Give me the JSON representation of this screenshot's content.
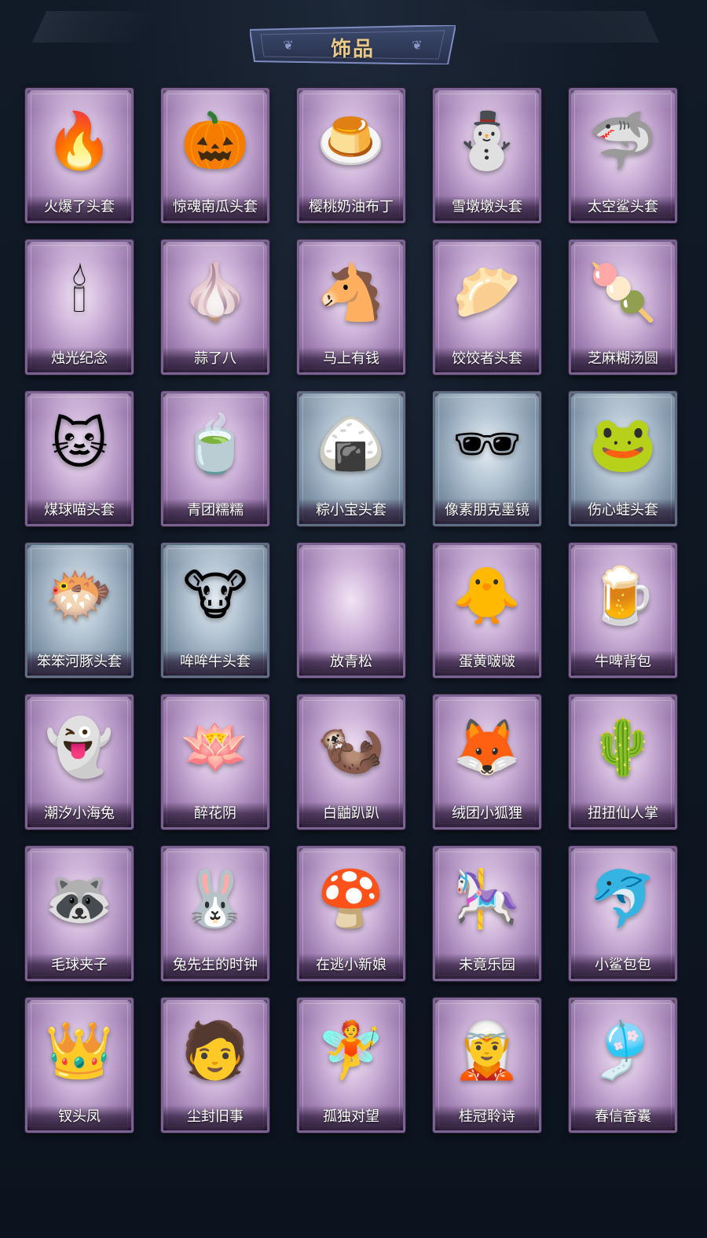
{
  "header": {
    "title": "饰品"
  },
  "colors": {
    "rarity_purple": "#a07fb2",
    "rarity_blue": "#8296aa",
    "title_gold": "#e8c98a",
    "background": "#0d1420"
  },
  "items": [
    {
      "name": "火爆了头套",
      "rarity": "purple",
      "icon": "fire-spirit-icon",
      "glyph": "🔥"
    },
    {
      "name": "惊魂南瓜头套",
      "rarity": "purple",
      "icon": "pumpkin-icon",
      "glyph": "🎃"
    },
    {
      "name": "樱桃奶油布丁",
      "rarity": "purple",
      "icon": "pudding-icon",
      "glyph": "🍮"
    },
    {
      "name": "雪墩墩头套",
      "rarity": "purple",
      "icon": "snowman-icon",
      "glyph": "⛄"
    },
    {
      "name": "太空鲨头套",
      "rarity": "purple",
      "icon": "shark-icon",
      "glyph": "🦈"
    },
    {
      "name": "烛光纪念",
      "rarity": "purple",
      "icon": "candle-icon",
      "glyph": "🕯"
    },
    {
      "name": "蒜了八",
      "rarity": "purple",
      "icon": "garlic-icon",
      "glyph": "🧄"
    },
    {
      "name": "马上有钱",
      "rarity": "purple",
      "icon": "horse-icon",
      "glyph": "🐴"
    },
    {
      "name": "饺饺者头套",
      "rarity": "purple",
      "icon": "dumpling-icon",
      "glyph": "🥟"
    },
    {
      "name": "芝麻糊汤圆",
      "rarity": "purple",
      "icon": "rice-ball-icon",
      "glyph": "🍡"
    },
    {
      "name": "煤球喵头套",
      "rarity": "purple",
      "icon": "cat-icon",
      "glyph": "🐱"
    },
    {
      "name": "青团糯糯",
      "rarity": "purple",
      "icon": "green-dumpling-icon",
      "glyph": "🍵"
    },
    {
      "name": "粽小宝头套",
      "rarity": "blue",
      "icon": "zongzi-icon",
      "glyph": "🍙"
    },
    {
      "name": "像素朋克墨镜",
      "rarity": "blue",
      "icon": "sunglasses-icon",
      "glyph": "🕶"
    },
    {
      "name": "伤心蛙头套",
      "rarity": "blue",
      "icon": "frog-icon",
      "glyph": "🐸"
    },
    {
      "name": "笨笨河豚头套",
      "rarity": "blue",
      "icon": "pufferfish-icon",
      "glyph": "🐡"
    },
    {
      "name": "哞哞牛头套",
      "rarity": "blue",
      "icon": "cow-icon",
      "glyph": "🐮"
    },
    {
      "name": "放青松",
      "rarity": "purple",
      "icon": "empty-slot-icon",
      "glyph": ""
    },
    {
      "name": "蛋黄啵啵",
      "rarity": "purple",
      "icon": "chick-icon",
      "glyph": "🐥"
    },
    {
      "name": "牛啤背包",
      "rarity": "purple",
      "icon": "beer-mug-icon",
      "glyph": "🍺"
    },
    {
      "name": "潮汐小海兔",
      "rarity": "purple",
      "icon": "sea-rabbit-icon",
      "glyph": "👻"
    },
    {
      "name": "醉花阴",
      "rarity": "purple",
      "icon": "ornament-icon",
      "glyph": "🪷"
    },
    {
      "name": "白鼬趴趴",
      "rarity": "purple",
      "icon": "weasel-icon",
      "glyph": "🦦"
    },
    {
      "name": "绒团小狐狸",
      "rarity": "purple",
      "icon": "fox-icon",
      "glyph": "🦊"
    },
    {
      "name": "扭扭仙人掌",
      "rarity": "purple",
      "icon": "cactus-icon",
      "glyph": "🌵"
    },
    {
      "name": "毛球夹子",
      "rarity": "purple",
      "icon": "raccoon-icon",
      "glyph": "🦝"
    },
    {
      "name": "兔先生的时钟",
      "rarity": "purple",
      "icon": "rabbit-clock-icon",
      "glyph": "🐰"
    },
    {
      "name": "在逃小新娘",
      "rarity": "purple",
      "icon": "mushroom-dress-icon",
      "glyph": "🍄"
    },
    {
      "name": "未竟乐园",
      "rarity": "purple",
      "icon": "clown-girl-icon",
      "glyph": "🎠"
    },
    {
      "name": "小鲨包包",
      "rarity": "purple",
      "icon": "shark-bag-icon",
      "glyph": "🐬"
    },
    {
      "name": "钗头凤",
      "rarity": "purple",
      "icon": "phoenix-crown-icon",
      "glyph": "👑"
    },
    {
      "name": "尘封旧事",
      "rarity": "purple",
      "icon": "chibi-boy-icon",
      "glyph": "🧑"
    },
    {
      "name": "孤独对望",
      "rarity": "purple",
      "icon": "chibi-girl-icon",
      "glyph": "🧚"
    },
    {
      "name": "桂冠聆诗",
      "rarity": "purple",
      "icon": "laurel-icon",
      "glyph": "🧝"
    },
    {
      "name": "春信香囊",
      "rarity": "purple",
      "icon": "sachet-icon",
      "glyph": "🎐"
    }
  ]
}
